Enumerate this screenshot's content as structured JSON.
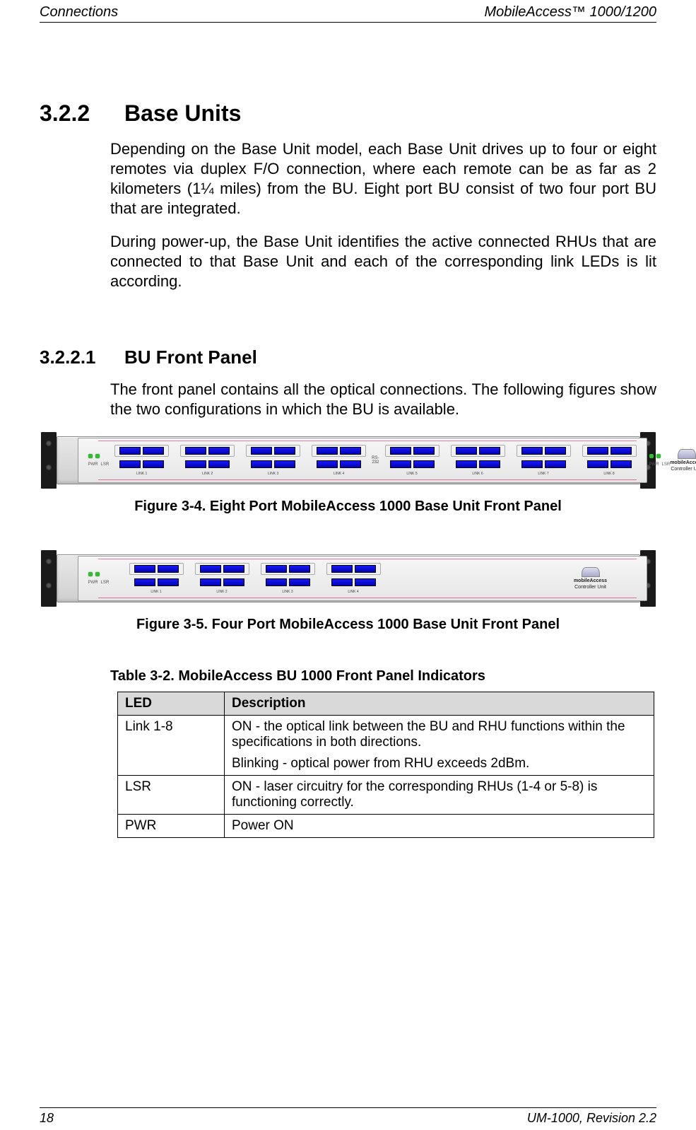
{
  "header": {
    "left": "Connections",
    "right": "MobileAccess™  1000/1200"
  },
  "section": {
    "num": "3.2.2",
    "title": "Base Units",
    "p1": "Depending on the Base Unit model, each Base Unit drives up to four or eight remotes via duplex F/O connection, where each remote can be as far as 2 kilometers (1¼ miles) from the BU.  Eight port BU consist of two four port BU that are integrated.",
    "p2": "During power-up, the Base Unit identifies the active connected RHUs that are connected to that Base Unit and each of the corresponding link LEDs is lit according."
  },
  "subsection": {
    "num": "3.2.2.1",
    "title": "BU Front Panel",
    "p1": "The front panel contains all the optical connections. The following figures show the two configurations in which the BU is available."
  },
  "figures": {
    "f1": {
      "caption": "Figure 3-4. Eight Port MobileAccess 1000 Base Unit Front Panel",
      "brand1": "mobileAccess",
      "brand2": "Controller Unit",
      "rs": "RS-232",
      "lsr": "LSR",
      "pwr": "PWR",
      "links": [
        "LINK 1",
        "LINK 2",
        "LINK 3",
        "LINK 4",
        "LINK 5",
        "LINK 6",
        "LINK 7",
        "LINK 8"
      ]
    },
    "f2": {
      "caption": "Figure 3-5. Four Port MobileAccess 1000 Base Unit Front Panel",
      "brand1": "mobileAccess",
      "brand2": "Controller Unit",
      "lsr": "LSR",
      "pwr": "PWR",
      "links": [
        "LINK 1",
        "LINK 2",
        "LINK 3",
        "LINK 4"
      ]
    }
  },
  "table": {
    "title": "Table 3-2. MobileAccess BU 1000 Front Panel Indicators",
    "headers": {
      "c1": "LED",
      "c2": "Description"
    },
    "rows": [
      {
        "c1": "Link 1-8",
        "c2a": "ON - the optical link between the BU and RHU functions within the specifications in both directions.",
        "c2b": "Blinking - optical power from RHU exceeds 2dBm."
      },
      {
        "c1": "LSR",
        "c2a": "ON - laser circuitry for the corresponding RHUs (1-4 or 5-8) is functioning correctly.",
        "c2b": ""
      },
      {
        "c1": "PWR",
        "c2a": "Power ON",
        "c2b": ""
      }
    ]
  },
  "footer": {
    "left": "18",
    "right": "UM-1000, Revision 2.2"
  }
}
